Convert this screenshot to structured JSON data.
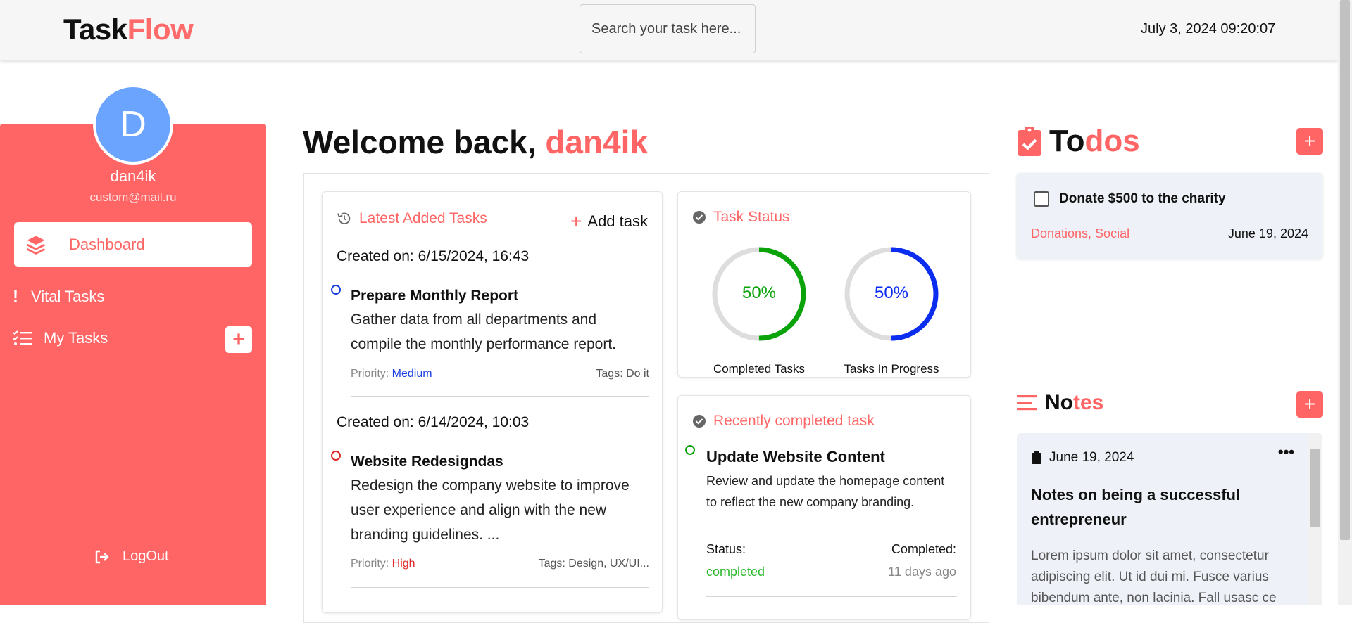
{
  "header": {
    "logo_part1": "Task",
    "logo_part2": "Flow",
    "search_placeholder": "Search your task here...",
    "datetime": "July 3, 2024 09:20:07"
  },
  "sidebar": {
    "avatar_letter": "D",
    "username": "dan4ik",
    "email": "custom@mail.ru",
    "items": [
      {
        "label": "Dashboard",
        "icon": "layers-icon"
      },
      {
        "label": "Vital Tasks",
        "icon": "exclamation-icon"
      },
      {
        "label": "My Tasks",
        "icon": "list-check-icon"
      }
    ],
    "logout_label": "LogOut"
  },
  "welcome": {
    "prefix": "Welcome back, ",
    "name": "dan4ik"
  },
  "latest": {
    "title": "Latest Added Tasks",
    "add_label": "Add task",
    "tasks": [
      {
        "created": "Created on: 6/15/2024, 16:43",
        "title": "Prepare Monthly Report",
        "description": "Gather data from all departments and compile the monthly performance report.",
        "priority_label": "Priority: ",
        "priority": "Medium",
        "tags": "Tags: Do it",
        "dot_color": "#1a3de0"
      },
      {
        "created": "Created on: 6/14/2024, 10:03",
        "title": "Website Redesigndas",
        "description": "Redesign the company website to improve user experience and align with the new branding guidelines. ...",
        "priority_label": "Priority: ",
        "priority": "High",
        "tags": "Tags: Design, UX/UI...",
        "dot_color": "#e02a2a"
      }
    ]
  },
  "status": {
    "title": "Task Status",
    "completed_pct": "50%",
    "completed_label": "Completed Tasks",
    "completed_value": 0.5,
    "progress_pct": "50%",
    "progress_label": "Tasks In Progress",
    "progress_value": 0.5,
    "colors": {
      "completed": "#0aa30a",
      "progress": "#0b2df0"
    }
  },
  "recent": {
    "title": "Recently completed task",
    "task_title": "Update Website Content",
    "task_desc": "Review and update the homepage content to reflect the new company branding.",
    "status_label": "Status:",
    "status_value": "completed",
    "completed_label": "Completed:",
    "completed_value": "11 days ago"
  },
  "todos": {
    "title_part1": "To",
    "title_part2": "dos",
    "items": [
      {
        "title": "Donate $500 to the charity",
        "tags": "Donations, Social",
        "date": "June 19, 2024"
      }
    ]
  },
  "notes": {
    "title_part1": "No",
    "title_part2": "tes",
    "items": [
      {
        "date": "June 19, 2024",
        "title": "Notes on being a successful entrepreneur",
        "body": "Lorem ipsum dolor sit amet, consectetur adipiscing elit. Ut id dui mi. Fusce varius bibendum ante, non lacinia. Fall usasc ce"
      }
    ]
  }
}
